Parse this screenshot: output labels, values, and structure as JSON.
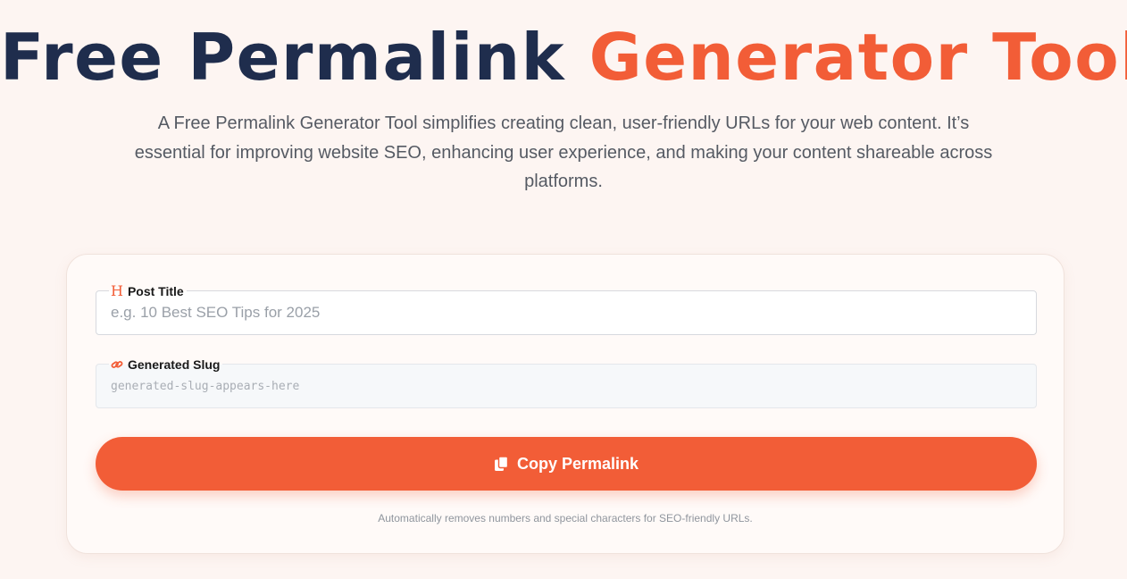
{
  "hero": {
    "title_part1": "Free Permalink ",
    "title_part2": "Generator Tool",
    "description": "A Free Permalink Generator Tool simplifies creating clean, user-friendly URLs for your web content. It’s essential for improving website SEO, enhancing user experience, and making your content shareable across platforms."
  },
  "form": {
    "post_title": {
      "label": "Post Title",
      "icon": "heading-icon",
      "icon_glyph": "H",
      "value": "",
      "placeholder": "e.g. 10 Best SEO Tips for 2025"
    },
    "slug": {
      "label": "Generated Slug",
      "icon": "link-icon",
      "value": "generated-slug-appears-here"
    },
    "copy_button": {
      "label": "Copy Permalink",
      "icon": "copy-icon"
    },
    "note": "Automatically removes numbers and special characters for SEO-friendly URLs."
  },
  "colors": {
    "background": "#fdf5f2",
    "title_dark": "#1f2d4d",
    "accent": "#f25d37",
    "body_text": "#555a63"
  }
}
